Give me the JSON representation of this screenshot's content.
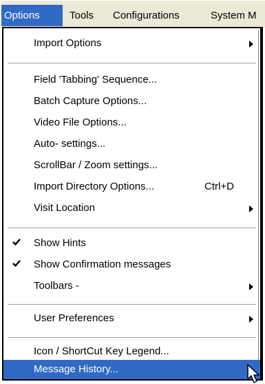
{
  "menubar": {
    "items": [
      {
        "label": "Options"
      },
      {
        "label": "Tools"
      },
      {
        "label": "Configurations"
      },
      {
        "label": "System M"
      }
    ]
  },
  "menu": {
    "items": [
      {
        "label": "Import Options",
        "submenu": true
      },
      {
        "label": "Field 'Tabbing' Sequence..."
      },
      {
        "label": "Batch Capture Options..."
      },
      {
        "label": "Video File Options..."
      },
      {
        "label": "Auto- settings..."
      },
      {
        "label": "ScrollBar / Zoom settings..."
      },
      {
        "label": "Import Directory Options...",
        "shortcut": "Ctrl+D"
      },
      {
        "label": "Visit Location",
        "submenu": true
      },
      {
        "label": "Show Hints",
        "checked": true
      },
      {
        "label": "Show Confirmation messages",
        "checked": true
      },
      {
        "label": "Toolbars -",
        "submenu": true
      },
      {
        "label": "User Preferences",
        "submenu": true
      },
      {
        "label": "Icon / ShortCut Key Legend..."
      },
      {
        "label": "Message History...",
        "highlighted": true
      }
    ]
  },
  "icons": {
    "check": "checkmark-icon",
    "submenu": "submenu-arrow-icon",
    "cursor": "mouse-pointer-icon"
  },
  "colors": {
    "highlight": "#316ac5",
    "menubar_bg": "#ece9d8",
    "menu_bg": "#ffffff"
  }
}
